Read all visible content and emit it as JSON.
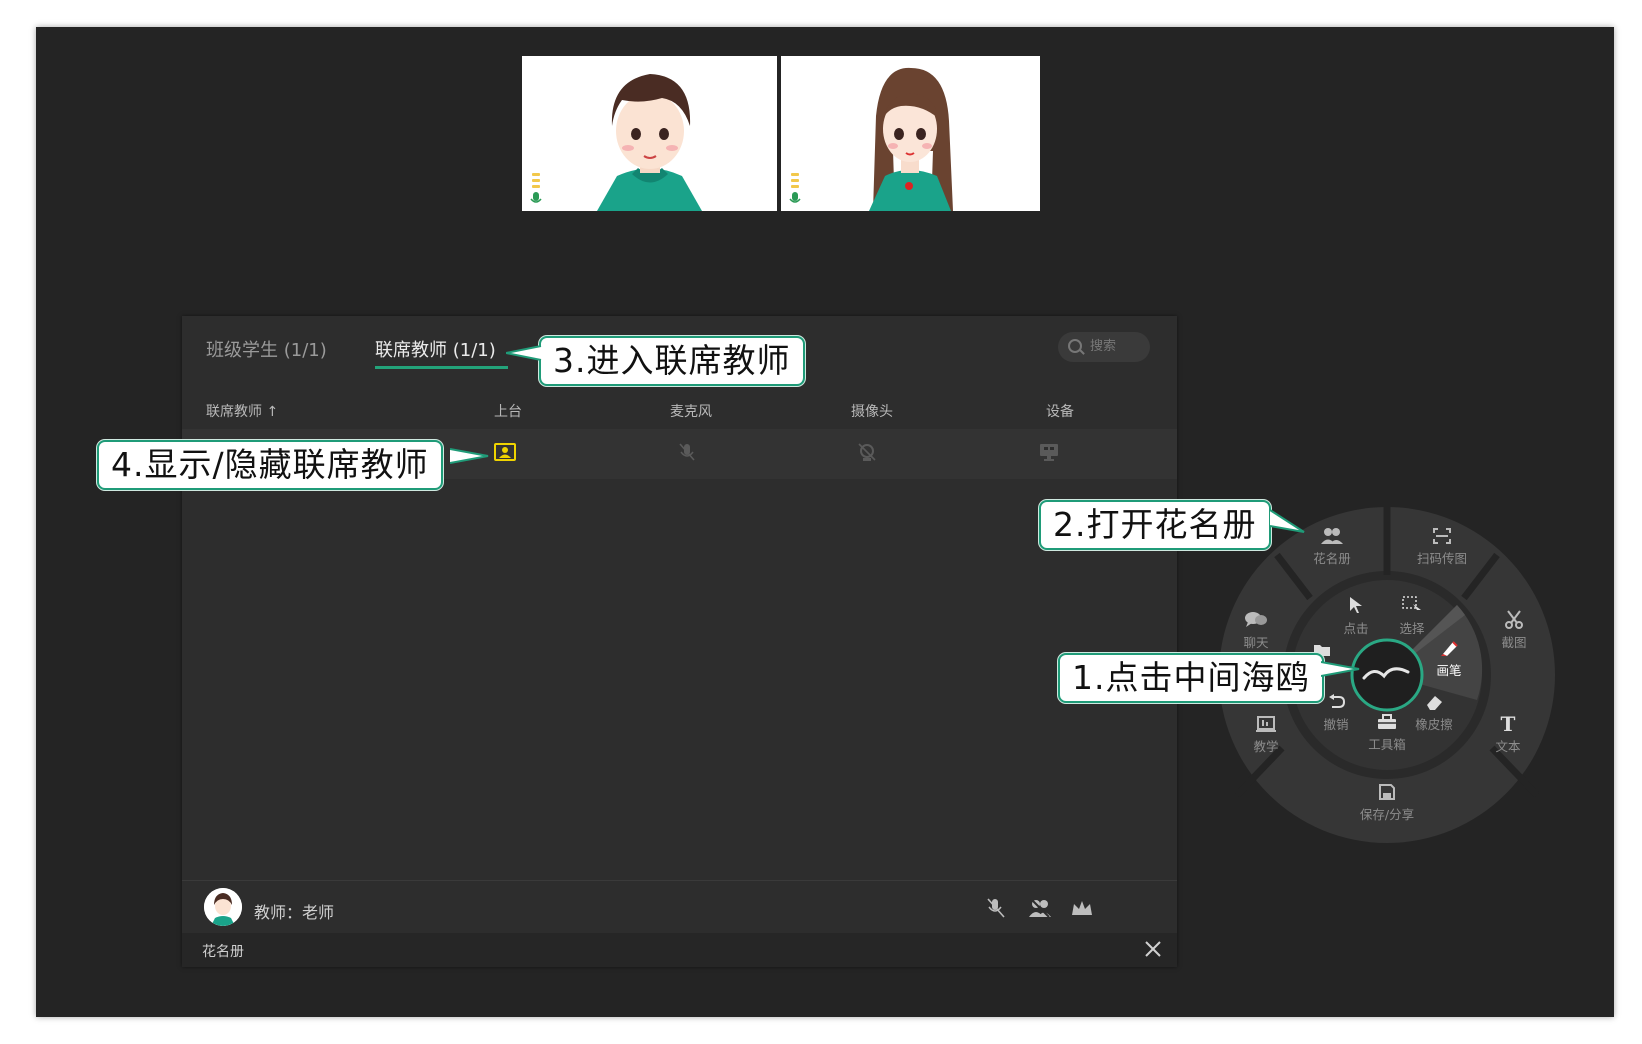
{
  "roster": {
    "tabs": [
      {
        "label": "班级学生 (1/1)",
        "active": false
      },
      {
        "label": "联席教师 (1/1)",
        "active": true
      }
    ],
    "search_placeholder": "搜索",
    "columns": [
      "联席教师 ↑",
      "上台",
      "麦克风",
      "摄像头",
      "设备"
    ],
    "teacher_label": "教师：老师",
    "title": "花名册"
  },
  "wheel": {
    "outer": [
      "花名册",
      "扫码传图",
      "截图",
      "文本",
      "保存/分享",
      "教学",
      "聊天"
    ],
    "inner": [
      "点击",
      "选择",
      "画笔",
      "橡皮擦",
      "工具箱",
      "撤销"
    ]
  },
  "callouts": {
    "c1": "1.点击中间海鸥",
    "c2": "2.打开花名册",
    "c3": "3.进入联席教师",
    "c4": "4.显示/隐藏联席教师"
  },
  "colors": {
    "accent": "#23a37a",
    "stage_highlight": "#f0d400",
    "background": "#242424"
  }
}
